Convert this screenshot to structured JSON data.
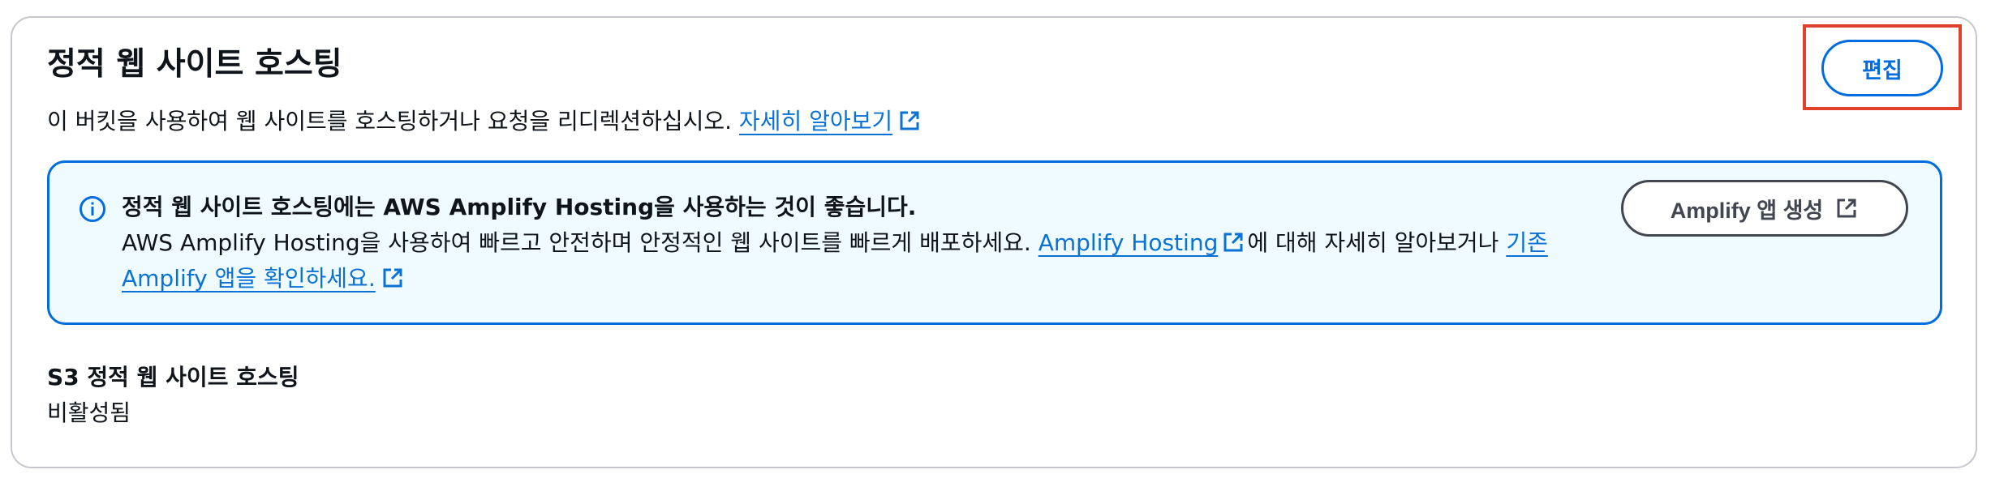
{
  "section": {
    "title": "정적 웹 사이트 호스팅",
    "description": "이 버킷을 사용하여 웹 사이트를 호스팅하거나 요청을 리디렉션하십시오.",
    "learn_more_link": "자세히 알아보기",
    "edit_button": "편집"
  },
  "alert": {
    "icon": "info-circle-icon",
    "title": "정적 웹 사이트 호스팅에는 AWS Amplify Hosting을 사용하는 것이 좋습니다.",
    "body_prefix": "AWS Amplify Hosting을 사용하여 빠르고 안전하며 안정적인 웹 사이트를 빠르게 배포하세요.",
    "amplify_link": "Amplify Hosting",
    "body_middle": "에 대해 자세히 알아보거나",
    "existing_apps_link": "기존 Amplify 앱을 확인하세요.",
    "create_button": "Amplify 앱 생성"
  },
  "status": {
    "label": "S3 정적 웹 사이트 호스팅",
    "value": "비활성됨"
  },
  "colors": {
    "link": "#0972d3",
    "primary_border": "#006ce0",
    "alert_background": "#f0fbff",
    "highlight": "#e0412c",
    "panel_border": "#c6c6cd"
  }
}
